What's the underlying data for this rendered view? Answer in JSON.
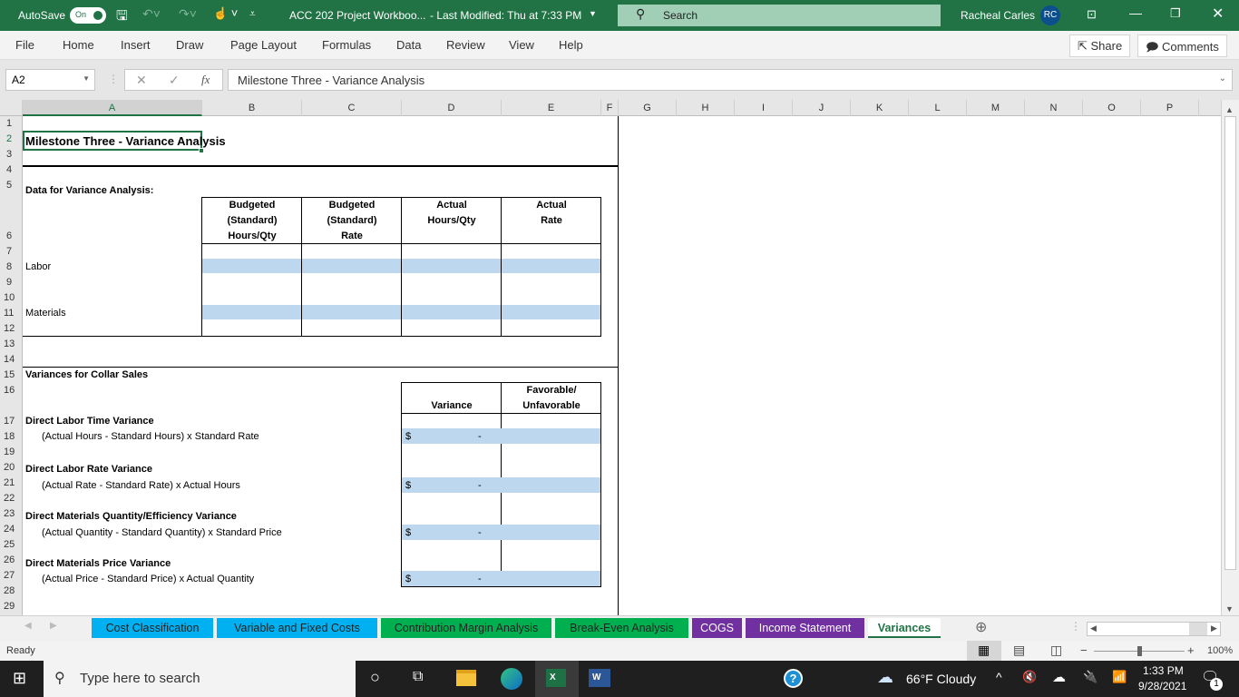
{
  "titlebar": {
    "autosave_label": "AutoSave",
    "autosave_state": "On",
    "doc_title": "ACC 202 Project Workboo...",
    "last_modified": "-  Last Modified: Thu at 7:33 PM",
    "search_placeholder": "Search",
    "user_name": "Racheal Carles",
    "user_initials": "RC"
  },
  "menu": {
    "items": [
      "File",
      "Home",
      "Insert",
      "Draw",
      "Page Layout",
      "Formulas",
      "Data",
      "Review",
      "View",
      "Help"
    ],
    "share_label": "Share",
    "comments_label": "Comments"
  },
  "formula_bar": {
    "name_box": "A2",
    "fx_label": "fx",
    "content": "Milestone Three - Variance Analysis"
  },
  "columns": [
    "A",
    "B",
    "C",
    "D",
    "E",
    "F",
    "G",
    "H",
    "I",
    "J",
    "K",
    "L",
    "M",
    "N",
    "O",
    "P"
  ],
  "selected_column": "A",
  "rows": [
    "1",
    "2",
    "3",
    "4",
    "5",
    "6",
    "7",
    "8",
    "9",
    "10",
    "11",
    "12",
    "13",
    "14",
    "15",
    "16",
    "17",
    "18",
    "19",
    "20",
    "21",
    "22",
    "23",
    "24",
    "25",
    "26",
    "27",
    "28",
    "29"
  ],
  "selected_row": "2",
  "sheet": {
    "title": "Milestone Three - Variance Analysis",
    "data_section_title": "Data for Variance Analysis:",
    "data_headers": [
      "Budgeted (Standard) Hours/Qty",
      "Budgeted (Standard) Rate",
      "Actual Hours/Qty",
      "Actual Rate"
    ],
    "data_header_lines": [
      [
        "Budgeted",
        "(Standard)",
        "Hours/Qty"
      ],
      [
        "Budgeted",
        "(Standard)",
        "Rate"
      ],
      [
        "Actual",
        "Hours/Qty"
      ],
      [
        "Actual",
        "Rate"
      ]
    ],
    "data_rows": [
      {
        "label": "Labor",
        "values": [
          "",
          "",
          "",
          ""
        ]
      },
      {
        "label": "Materials",
        "values": [
          "",
          "",
          "",
          ""
        ]
      }
    ],
    "variance_section_title": "Variances for Collar Sales",
    "variance_header": "Variance",
    "fav_header_lines": [
      "Favorable/",
      "Unfavorable"
    ],
    "variances": [
      {
        "name": "Direct Labor Time Variance",
        "formula": "(Actual Hours - Standard Hours) x Standard Rate",
        "currency": "$",
        "value": "-",
        "fav": ""
      },
      {
        "name": "Direct Labor Rate Variance",
        "formula": "(Actual Rate - Standard Rate) x Actual Hours",
        "currency": "$",
        "value": "-",
        "fav": ""
      },
      {
        "name": "Direct Materials Quantity/Efficiency Variance",
        "formula": "(Actual Quantity - Standard Quantity) x Standard Price",
        "currency": "$",
        "value": "-",
        "fav": ""
      },
      {
        "name": "Direct Materials Price Variance",
        "formula": "(Actual Price - Standard Price) x Actual Quantity",
        "currency": "$",
        "value": "-",
        "fav": ""
      }
    ]
  },
  "sheet_tabs": [
    {
      "label": "Cost Classification",
      "color": "#00b0f0"
    },
    {
      "label": "Variable and Fixed Costs",
      "color": "#00b0f0"
    },
    {
      "label": "Contribution Margin Analysis",
      "color": "#00b050"
    },
    {
      "label": "Break-Even Analysis",
      "color": "#00b050"
    },
    {
      "label": "COGS",
      "color": "#7030a0"
    },
    {
      "label": "Income Statement",
      "color": "#7030a0"
    },
    {
      "label": "Variances",
      "color": "#ffffff",
      "active": true
    }
  ],
  "status": {
    "text": "Ready",
    "zoom": "100%",
    "zoom_level_percent": 100
  },
  "taskbar": {
    "search_placeholder": "Type here to search",
    "weather": "66°F  Cloudy",
    "time": "1:33 PM",
    "date": "9/28/2021",
    "notification_count": "1"
  },
  "colors": {
    "excel_green": "#217346",
    "input_fill": "#bdd7ee"
  }
}
